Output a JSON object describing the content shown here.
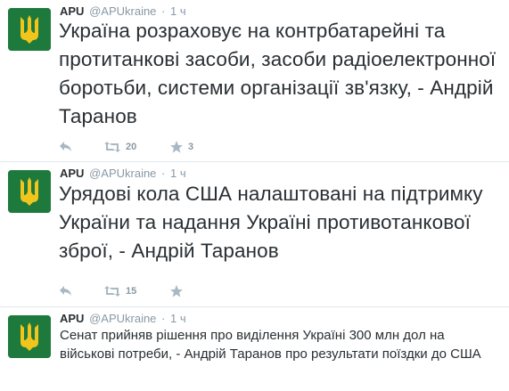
{
  "tweets": [
    {
      "fullname": "APU",
      "username": "@APUkraine",
      "separator": "·",
      "time": "1 ч",
      "text": "Україна розраховує на контрбатарейні та протитанкові засоби, засоби радіоелектронної боротьби, системи організації зв'язку, - Андрій Таранов",
      "retweets": "20",
      "favorites": "3"
    },
    {
      "fullname": "APU",
      "username": "@APUkraine",
      "separator": "·",
      "time": "1 ч",
      "text": "Урядові кола США налаштовані на підтримку України та надання Україні противотанкової зброї, - Андрій Таранов",
      "retweets": "15",
      "favorites": ""
    },
    {
      "fullname": "APU",
      "username": "@APUkraine",
      "separator": "·",
      "time": "1 ч",
      "text": "Сенат прийняв рішення про виділення Україні 300 млн дол на військові потреби, - Андрій Таранов про результати поїздки до США"
    }
  ],
  "icons": {
    "reply": "reply-icon",
    "retweet": "retweet-icon",
    "favorite": "star-icon",
    "avatar": "trident-emblem"
  },
  "colors": {
    "avatar_bg": "#1d7a3c",
    "emblem": "#f2c51c",
    "action_icon": "#aab8c2",
    "secondary_text": "#8899a6"
  }
}
